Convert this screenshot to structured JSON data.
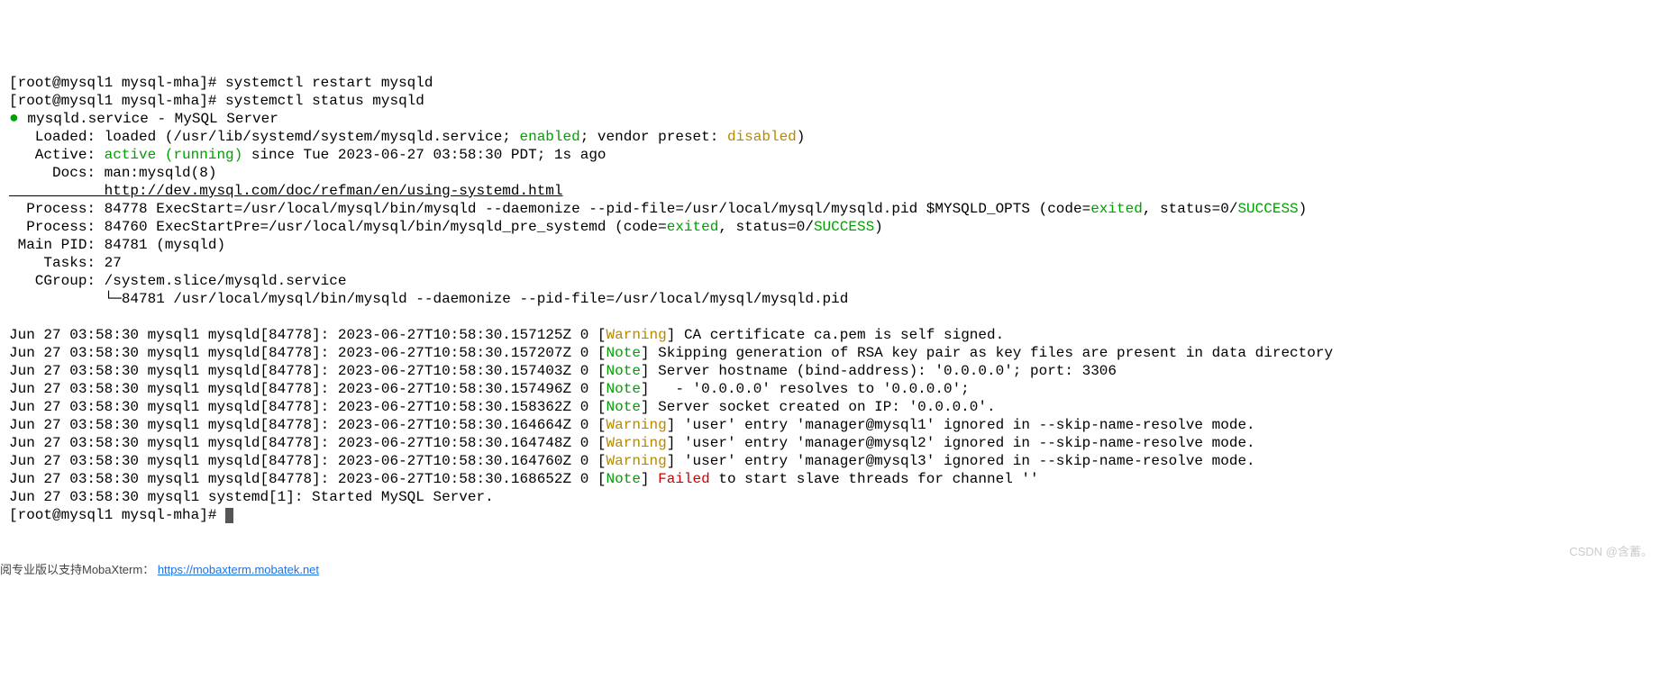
{
  "prompt1": "[root@mysql1 mysql-mha]# ",
  "cmd1": "systemctl restart mysqld",
  "prompt2": "[root@mysql1 mysql-mha]# ",
  "cmd2": "systemctl status mysqld",
  "dot": "●",
  "service_line": " mysqld.service - MySQL Server",
  "loaded_label": "   Loaded: loaded (/usr/lib/systemd/system/mysqld.service; ",
  "enabled": "enabled",
  "loaded_mid": "; vendor preset: ",
  "disabled": "disabled",
  "loaded_end": ")",
  "active_label": "   Active: ",
  "active_status": "active (running)",
  "active_since": " since Tue 2023-06-27 03:58:30 PDT; 1s ago",
  "docs_label": "     Docs: man:mysqld(8)",
  "docs_url": "           http://dev.mysql.com/doc/refman/en/using-systemd.html",
  "proc1_a": "  Process: 84778 ExecStart=/usr/local/mysql/bin/mysqld --daemonize --pid-file=/usr/local/mysql/mysqld.pid $MYSQLD_OPTS (code=",
  "exited1": "exited",
  "proc1_b": ", status=0/",
  "success1": "SUCCESS",
  "proc1_c": ")",
  "proc2_a": "  Process: 84760 ExecStartPre=/usr/local/mysql/bin/mysqld_pre_systemd (code=",
  "exited2": "exited",
  "proc2_b": ", status=0/",
  "success2": "SUCCESS",
  "proc2_c": ")",
  "mainpid": " Main PID: 84781 (mysqld)",
  "tasks": "    Tasks: 27",
  "cgroup": "   CGroup: /system.slice/mysqld.service",
  "cgroup2": "           └─84781 /usr/local/mysql/bin/mysqld --daemonize --pid-file=/usr/local/mysql/mysqld.pid",
  "blank": "",
  "log1_a": "Jun 27 03:58:30 mysql1 mysqld[84778]: 2023-06-27T10:58:30.157125Z 0 [",
  "log1_tag": "Warning",
  "log1_b": "] CA certificate ca.pem is self signed.",
  "log2_a": "Jun 27 03:58:30 mysql1 mysqld[84778]: 2023-06-27T10:58:30.157207Z 0 [",
  "log2_tag": "Note",
  "log2_b": "] Skipping generation of RSA key pair as key files are present in data directory",
  "log3_a": "Jun 27 03:58:30 mysql1 mysqld[84778]: 2023-06-27T10:58:30.157403Z 0 [",
  "log3_tag": "Note",
  "log3_b": "] Server hostname (bind-address): '0.0.0.0'; port: 3306",
  "log4_a": "Jun 27 03:58:30 mysql1 mysqld[84778]: 2023-06-27T10:58:30.157496Z 0 [",
  "log4_tag": "Note",
  "log4_b": "]   - '0.0.0.0' resolves to '0.0.0.0';",
  "log5_a": "Jun 27 03:58:30 mysql1 mysqld[84778]: 2023-06-27T10:58:30.158362Z 0 [",
  "log5_tag": "Note",
  "log5_b": "] Server socket created on IP: '0.0.0.0'.",
  "log6_a": "Jun 27 03:58:30 mysql1 mysqld[84778]: 2023-06-27T10:58:30.164664Z 0 [",
  "log6_tag": "Warning",
  "log6_b": "] 'user' entry 'manager@mysql1' ignored in --skip-name-resolve mode.",
  "log7_a": "Jun 27 03:58:30 mysql1 mysqld[84778]: 2023-06-27T10:58:30.164748Z 0 [",
  "log7_tag": "Warning",
  "log7_b": "] 'user' entry 'manager@mysql2' ignored in --skip-name-resolve mode.",
  "log8_a": "Jun 27 03:58:30 mysql1 mysqld[84778]: 2023-06-27T10:58:30.164760Z 0 [",
  "log8_tag": "Warning",
  "log8_b": "] 'user' entry 'manager@mysql3' ignored in --skip-name-resolve mode.",
  "log9_a": "Jun 27 03:58:30 mysql1 mysqld[84778]: 2023-06-27T10:58:30.168652Z 0 [",
  "log9_tag": "Note",
  "log9_b": "] ",
  "log9_fail": "Failed",
  "log9_c": " to start slave threads for channel ''",
  "log10": "Jun 27 03:58:30 mysql1 systemd[1]: Started MySQL Server.",
  "prompt3": "[root@mysql1 mysql-mha]# ",
  "watermark": "CSDN @含蓄。",
  "footer_a": "阅专业版以支持MobaXterm：",
  "footer_b": "https://mobaxterm.mobatek.net"
}
